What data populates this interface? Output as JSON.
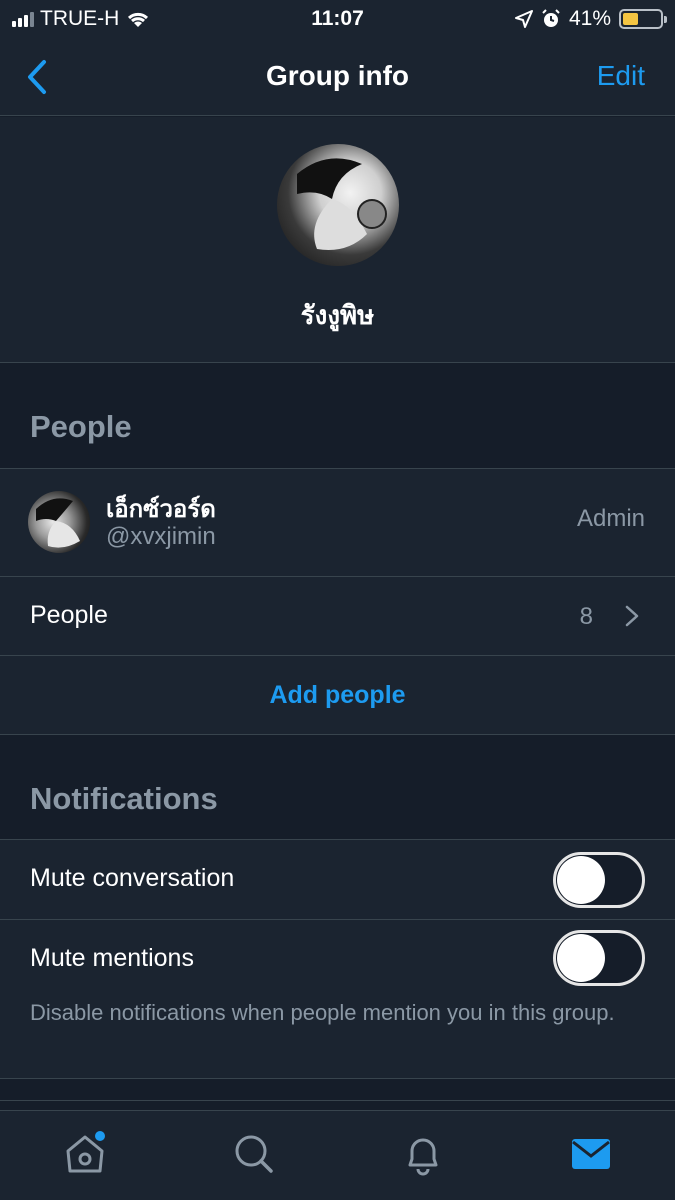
{
  "status": {
    "carrier": "TRUE-H",
    "time": "11:07",
    "battery": "41%",
    "battery_level": 0.41
  },
  "nav": {
    "title": "Group info",
    "edit_label": "Edit",
    "back_icon": "chevron-left-icon"
  },
  "group": {
    "name": "รังงูพิษ"
  },
  "people_section": {
    "header": "People",
    "admin": {
      "name": "เอ็กซ์วอร์ด",
      "handle": "@xvxjimin",
      "role": "Admin"
    },
    "people_row": {
      "label": "People",
      "count": "8"
    },
    "add_people_label": "Add people"
  },
  "notifications_section": {
    "header": "Notifications",
    "mute_conversation_label": "Mute conversation",
    "mute_conversation_on": false,
    "mute_mentions_label": "Mute mentions",
    "mute_mentions_on": false,
    "mute_mentions_help": "Disable notifications when people mention you in this group."
  },
  "tabbar": {
    "items": [
      "home-icon",
      "search-icon",
      "bell-icon",
      "mail-icon"
    ],
    "accent": "#1d9bf0"
  }
}
